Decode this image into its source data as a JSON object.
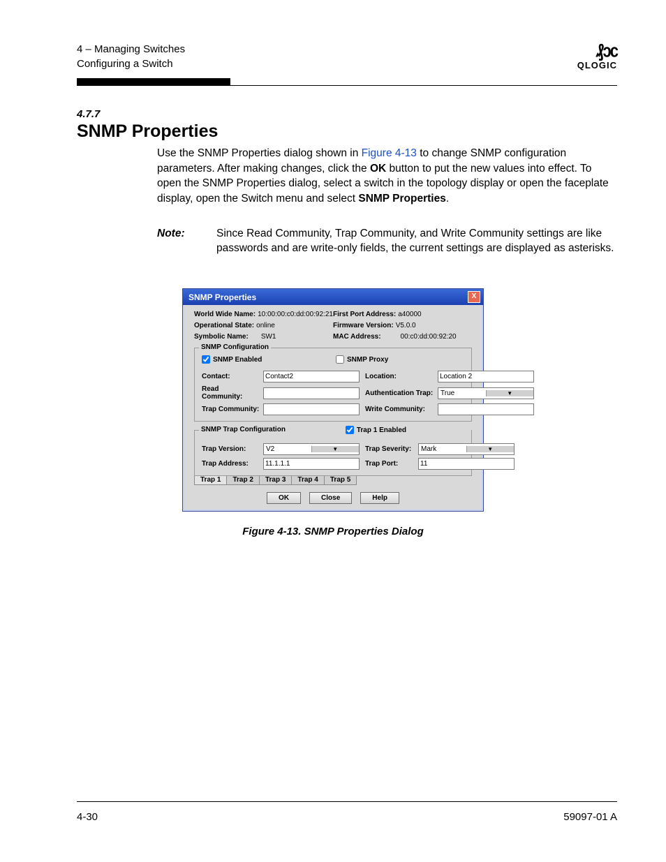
{
  "header": {
    "line1": "4 – Managing Switches",
    "line2": "Configuring a Switch",
    "brand": "QLOGIC"
  },
  "section": {
    "num": "4.7.7",
    "title": "SNMP Properties",
    "para_pre": "Use the SNMP Properties dialog shown in ",
    "fig_link": "Figure 4-13",
    "para_mid1": " to change SNMP configuration parameters. After making changes, click the ",
    "ok_bold": "OK",
    "para_mid2": " button to put the new values into effect. To open the SNMP Properties dialog, select a switch in the topology display or open the faceplate display, open the Switch menu and select ",
    "prop_bold": "SNMP Properties",
    "para_end": "."
  },
  "note": {
    "label": "Note:",
    "text": "Since Read Community, Trap Community, and Write Community settings are like passwords and are write-only fields, the current settings are displayed as asterisks."
  },
  "dialog": {
    "title": "SNMP Properties",
    "close_x": "X",
    "info": {
      "wwn_l": "World Wide Name:",
      "wwn_v": "10:00:00:c0:dd:00:92:21",
      "fpa_l": "First Port Address:",
      "fpa_v": "a40000",
      "ops_l": "Operational State:",
      "ops_v": "online",
      "fw_l": "Firmware Version:",
      "fw_v": "V5.0.0",
      "sym_l": "Symbolic Name:",
      "sym_v": "SW1",
      "mac_l": "MAC Address:",
      "mac_v": "00:c0:dd:00:92:20"
    },
    "grp1": {
      "title": "SNMP Configuration",
      "snmp_enabled": "SNMP Enabled",
      "snmp_proxy": "SNMP Proxy",
      "contact_l": "Contact:",
      "contact_v": "Contact2",
      "location_l": "Location:",
      "location_v": "Location 2",
      "readcomm_l": "Read Community:",
      "readcomm_v": "",
      "auth_l": "Authentication Trap:",
      "auth_v": "True",
      "trapcomm_l": "Trap Community:",
      "trapcomm_v": "",
      "writecomm_l": "Write Community:",
      "writecomm_v": ""
    },
    "grp2": {
      "title": "SNMP Trap Configuration",
      "trap1_enabled": "Trap 1 Enabled",
      "trapver_l": "Trap Version:",
      "trapver_v": "V2",
      "trapsev_l": "Trap Severity:",
      "trapsev_v": "Mark",
      "trapaddr_l": "Trap Address:",
      "trapaddr_v": "11.1.1.1",
      "trapport_l": "Trap Port:",
      "trapport_v": "11"
    },
    "tabs": [
      "Trap 1",
      "Trap 2",
      "Trap 3",
      "Trap 4",
      "Trap 5"
    ],
    "buttons": {
      "ok": "OK",
      "close": "Close",
      "help": "Help"
    }
  },
  "caption": "Figure 4-13.  SNMP Properties Dialog",
  "footer": {
    "left": "4-30",
    "right": "59097-01 A"
  }
}
